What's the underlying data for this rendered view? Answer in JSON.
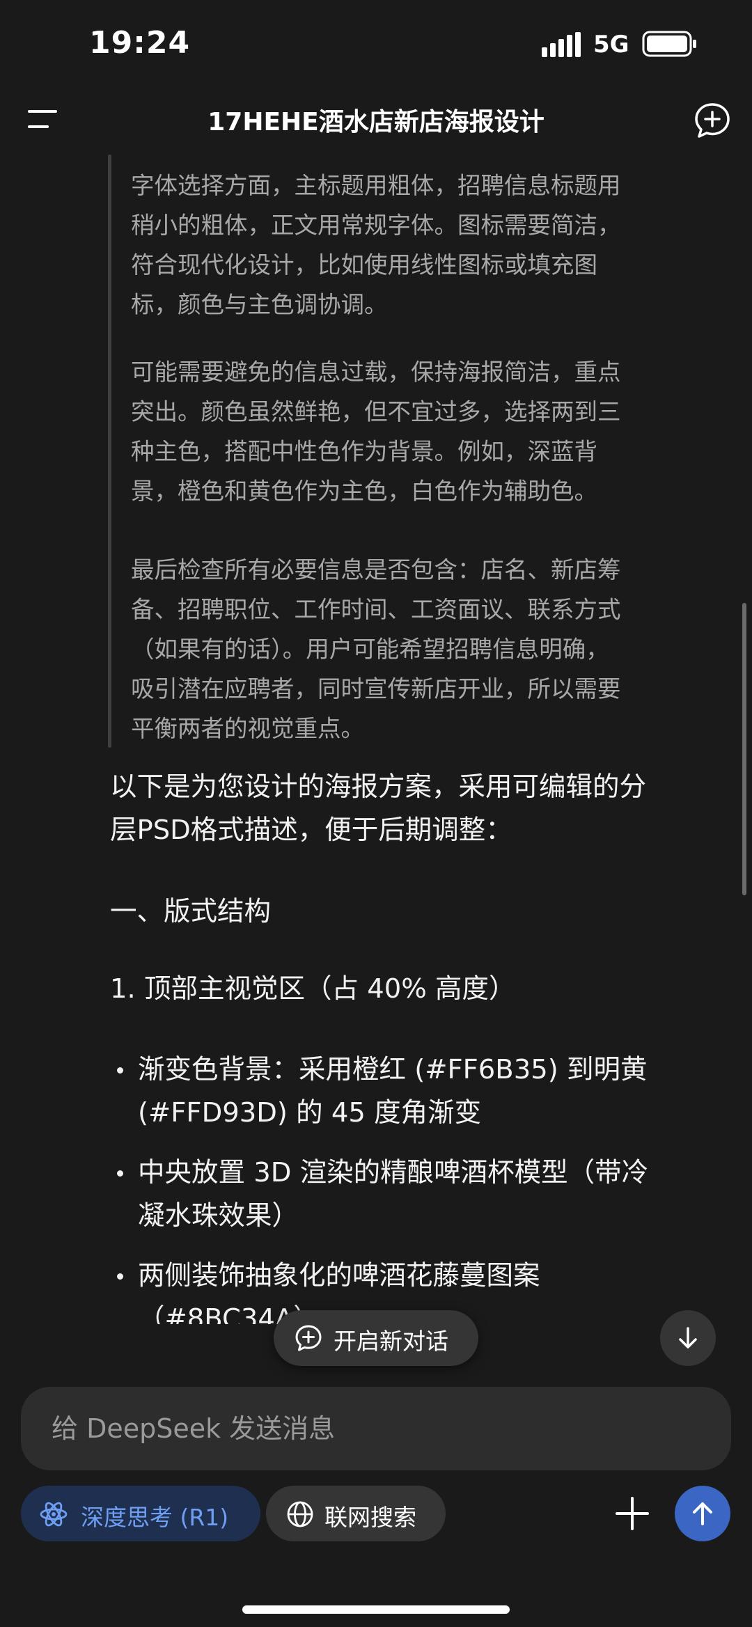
{
  "status_bar": {
    "time": "19:24",
    "network": "5G",
    "signal_icon": "signal-bars-icon",
    "battery_icon": "battery-icon"
  },
  "header": {
    "title": "17HEHE酒水店新店海报设计",
    "menu_icon": "menu-icon",
    "new_chat_icon": "new-chat-icon"
  },
  "thinking": {
    "paragraphs": [
      [
        "字体选择方面，主标题用粗体，招聘信息标题用",
        "稍小的粗体，正文用常规字体。图标需要简洁，",
        "符合现代化设计，比如使用线性图标或填充图",
        "标，颜色与主色调协调。"
      ],
      [
        "可能需要避免的信息过载，保持海报简洁，重点",
        "突出。颜色虽然鲜艳，但不宜过多，选择两到三",
        "种主色，搭配中性色作为背景。例如，深蓝背",
        "景，橙色和黄色作为主色，白色作为辅助色。"
      ],
      [
        "最后检查所有必要信息是否包含：店名、新店筹",
        "备、招聘职位、工作时间、工资面议、联系方式",
        "（如果有的话）。用户可能希望招聘信息明确，",
        "吸引潜在应聘者，同时宣传新店开业，所以需要",
        "平衡两者的视觉重点。"
      ]
    ]
  },
  "answer": {
    "intro": [
      "以下是为您设计的海报方案，采用可编辑的分",
      "层PSD格式描述，便于后期调整："
    ],
    "section_heading": "一、版式结构",
    "subsection": "1. 顶部主视觉区（占 40% 高度）",
    "bullets": [
      [
        "渐变色背景：采用橙红 (#FF6B35) 到明黄",
        "(#FFD93D) 的 45 度角渐变"
      ],
      [
        "中央放置 3D 渲染的精酿啤酒杯模型（带冷",
        "凝水珠效果）"
      ],
      [
        "两侧装饰抽象化的啤酒花藤蔓图案",
        "（#8BC34A）"
      ]
    ]
  },
  "floating": {
    "new_chat_label": "开启新对话"
  },
  "composer": {
    "placeholder": "给 DeepSeek 发送消息",
    "deep_think_label": "深度思考 (R1)",
    "web_search_label": "联网搜索"
  },
  "colors": {
    "background": "#1a1a1a",
    "accent_blue": "#3b66c4",
    "chip_active_text": "#6e9ff5",
    "secondary_text": "#a8a8a8"
  }
}
